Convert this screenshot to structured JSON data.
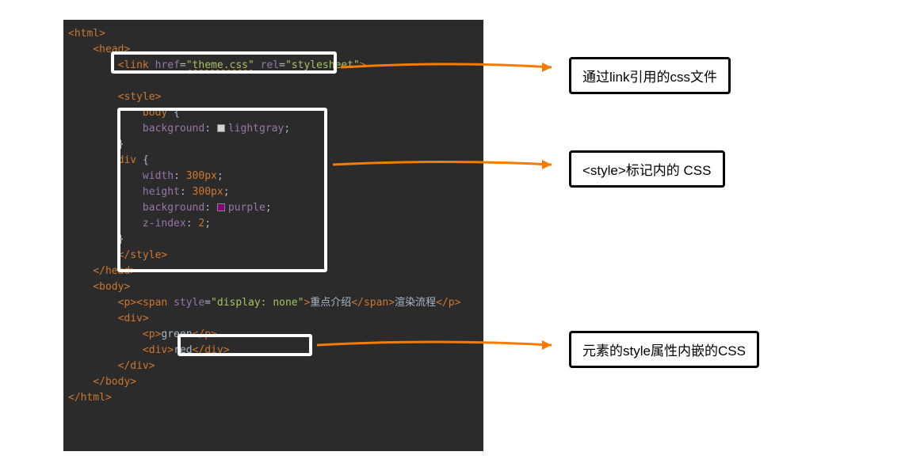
{
  "labels": {
    "link_css": "通过link引用的css文件",
    "style_css": "<style>标记内的 CSS",
    "inline_css": "元素的style属性内嵌的CSS"
  },
  "code": {
    "html_open": "<html>",
    "head_open": "<head>",
    "link_tag_open": "<link",
    "link_href_name": "href",
    "link_href_val": "\"theme.css\"",
    "link_rel_name": "rel",
    "link_rel_val": "\"stylesheet\"",
    "link_close": ">",
    "style_open": "<style>",
    "body_sel": "body {",
    "bg_prop": "background",
    "lightgray_val": "lightgray",
    "body_close": "}",
    "div_sel": "div {",
    "width_prop": "width",
    "width_val": "300px",
    "height_prop": "height",
    "height_val": "300px",
    "purple_val": "purple",
    "zindex_prop": "z-index",
    "zindex_val": "2",
    "div_close": "}",
    "style_close": "</style>",
    "head_close": "</head>",
    "body_open": "<body>",
    "p_open": "<p>",
    "span_open": "<span",
    "style_attr": "style",
    "style_attr_val": "\"display: none\"",
    "span_close_bracket": ">",
    "span_text1": "重点介绍",
    "span_close": "</span>",
    "after_span_text": "渲染流程",
    "p_close": "</p>",
    "div_open": "<div>",
    "green_text": "green",
    "red_text": "red",
    "div_closetag": "</div>",
    "body_closetag": "</body>",
    "html_close": "</html>"
  }
}
